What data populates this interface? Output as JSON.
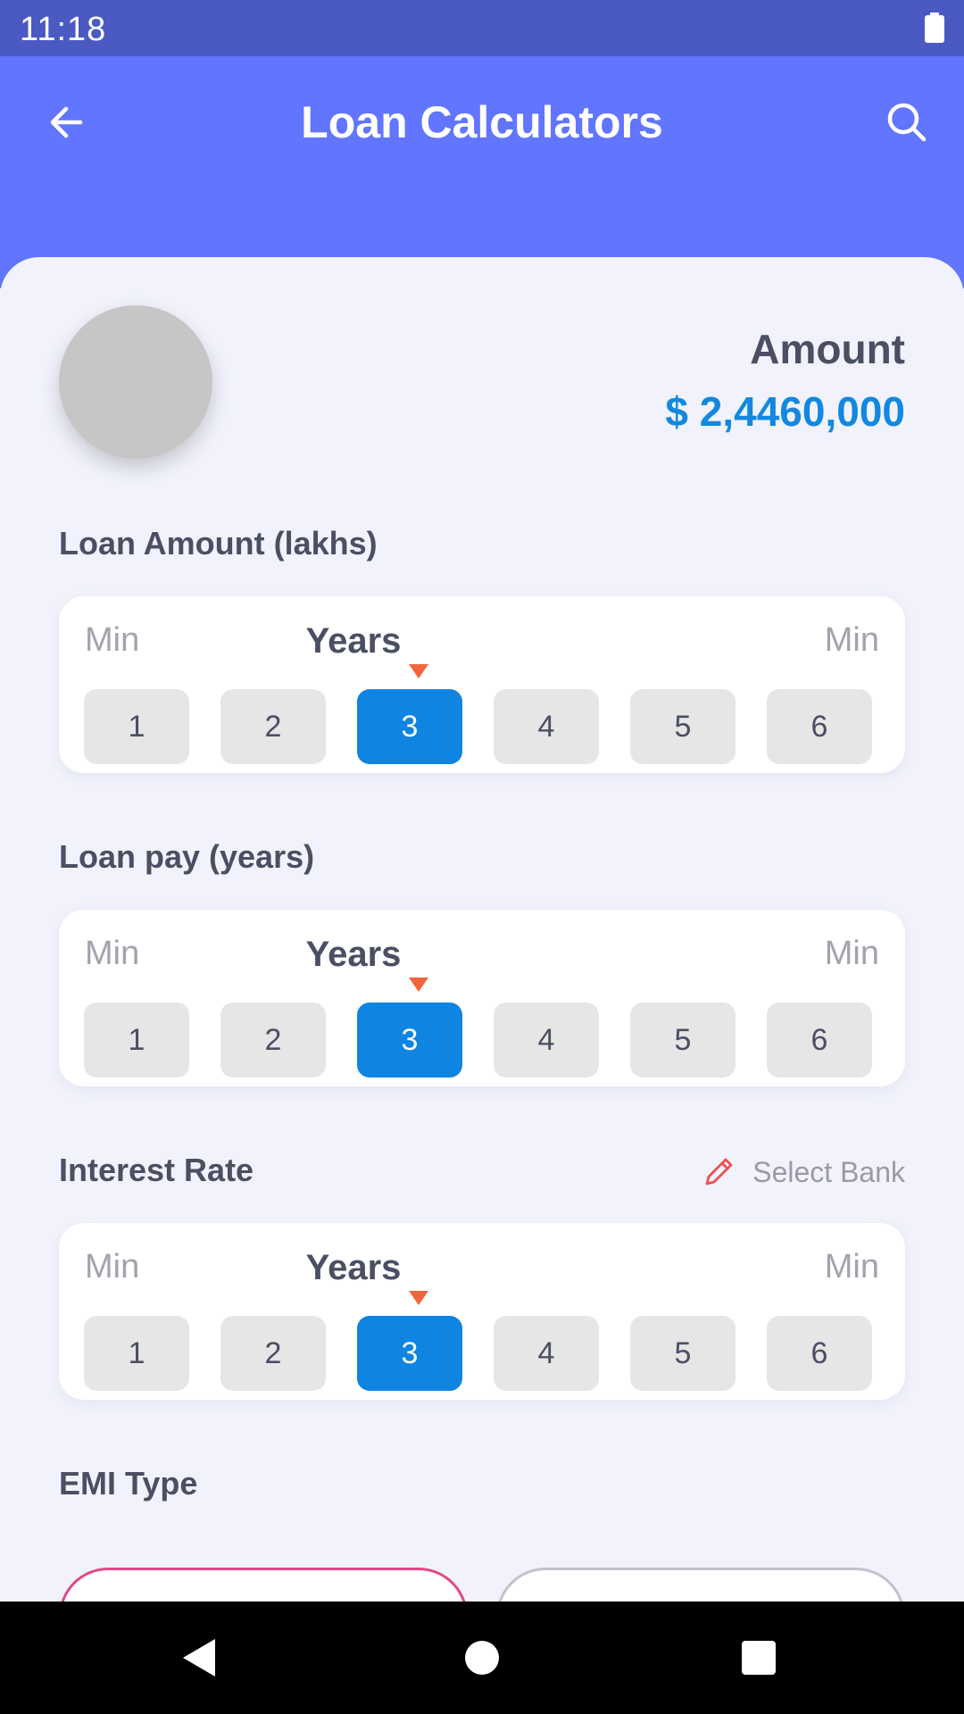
{
  "status_bar": {
    "time": "11:18"
  },
  "app_bar": {
    "title": "Loan Calculators",
    "back_icon": "arrow-left-icon",
    "search_icon": "search-icon"
  },
  "summary": {
    "amount_label": "Amount",
    "amount_value": "$ 2,4460,000"
  },
  "sections": [
    {
      "label": "Loan Amount (lakhs)",
      "min_left": "Min",
      "title": "Years",
      "min_right": "Min",
      "options": [
        "1",
        "2",
        "3",
        "4",
        "5",
        "6"
      ],
      "selected": "3"
    },
    {
      "label": "Loan pay (years)",
      "min_left": "Min",
      "title": "Years",
      "min_right": "Min",
      "options": [
        "1",
        "2",
        "3",
        "4",
        "5",
        "6"
      ],
      "selected": "3"
    },
    {
      "label": "Interest Rate",
      "min_left": "Min",
      "title": "Years",
      "min_right": "Min",
      "options": [
        "1",
        "2",
        "3",
        "4",
        "5",
        "6"
      ],
      "selected": "3"
    }
  ],
  "select_bank": {
    "label": "Select Bank",
    "icon": "pencil-icon"
  },
  "emi_type": {
    "label": "EMI Type"
  },
  "colors": {
    "app_bar": "#6175fe",
    "status_bar": "#4a5ac2",
    "accent": "#0f84e0",
    "amount": "#1288e0",
    "pointer": "#f2643c",
    "emi_active_border": "#e0488a"
  }
}
